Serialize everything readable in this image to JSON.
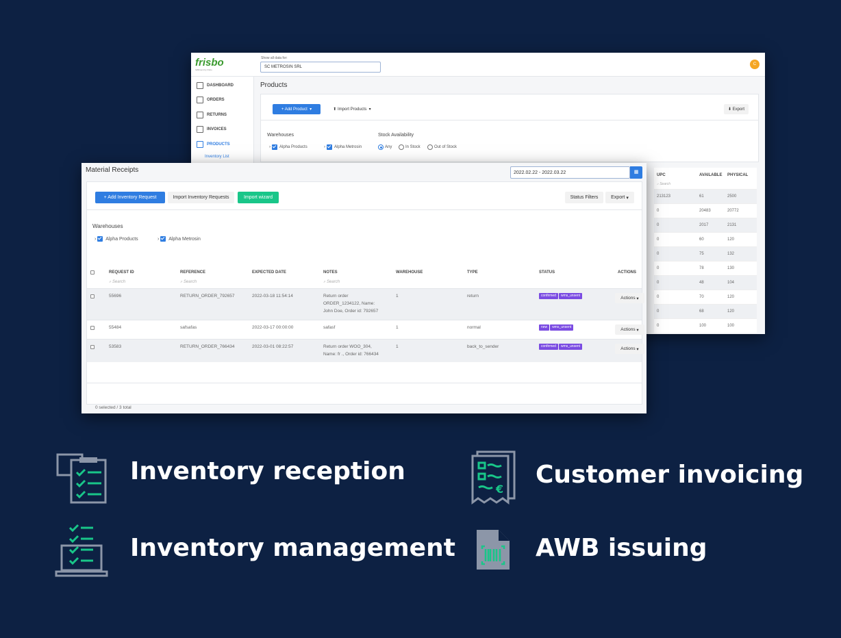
{
  "bg": {
    "logo": "frisbo",
    "logo_sub": "fulfillment by frisbo",
    "show_label": "Show all data for:",
    "company": "SC METROSIN SRL",
    "avatar": "C",
    "nav": [
      {
        "label": "DASHBOARD",
        "icon": "bar-chart-icon"
      },
      {
        "label": "ORDERS",
        "icon": "cart-icon"
      },
      {
        "label": "RETURNS",
        "icon": "return-box-icon"
      },
      {
        "label": "INVOICES",
        "icon": "invoice-icon"
      },
      {
        "label": "PRODUCTS",
        "icon": "list-icon"
      }
    ],
    "subnav": "Inventory List",
    "page_title": "Products",
    "add_product": "+ Add Product",
    "import_products": "Import Products",
    "export": "Export",
    "warehouses_label": "Warehouses",
    "wh1": "Alpha Products",
    "wh2": "Alpha Metrosin",
    "stock_label": "Stock Availability",
    "stock_options": [
      "Any",
      "In Stock",
      "Out of Stock"
    ],
    "stock_selected": "Any",
    "table": {
      "headers": [
        "UPC",
        "AVAILABLE",
        "PHYSICAL"
      ],
      "search": "Search",
      "rows": [
        [
          "213123",
          "61",
          "2500"
        ],
        [
          "0",
          "20483",
          "20772"
        ],
        [
          "0",
          "2017",
          "2131"
        ],
        [
          "0",
          "60",
          "120"
        ],
        [
          "0",
          "75",
          "132"
        ],
        [
          "0",
          "78",
          "130"
        ],
        [
          "0",
          "48",
          "104"
        ],
        [
          "0",
          "70",
          "120"
        ],
        [
          "0",
          "68",
          "120"
        ],
        [
          "0",
          "100",
          "100"
        ]
      ]
    }
  },
  "fg": {
    "title": "Material Receipts",
    "date_range": "2022.02.22 - 2022.03.22",
    "add_request": "+ Add Inventory Request",
    "import_requests": "Import Inventory Requests",
    "import_wizard": "Import wizard",
    "status_filters": "Status Filters",
    "export": "Export",
    "warehouses_label": "Warehouses",
    "wh1": "Alpha Products",
    "wh2": "Alpha Metrosin",
    "headers": [
      "REQUEST ID",
      "REFERENCE",
      "EXPECTED DATE",
      "NOTES",
      "WAREHOUSE",
      "TYPE",
      "STATUS",
      "ACTIONS"
    ],
    "search": "Search",
    "rows": [
      {
        "id": "55696",
        "ref": "RETURN_ORDER_792657",
        "date": "2022-03-18 11:54:14",
        "notes": [
          "Return order",
          "ORDER_1234122, Name:",
          "John Doe, Order id: 792657"
        ],
        "wh": "1",
        "type": "return",
        "badges": [
          "confirmed",
          "wms_unsent"
        ]
      },
      {
        "id": "55484",
        "ref": "safsafas",
        "date": "2022-03-17 00:00:00",
        "notes": [
          "safasf"
        ],
        "wh": "1",
        "type": "normal",
        "badges": [
          "new",
          "wms_unsent"
        ]
      },
      {
        "id": "53583",
        "ref": "RETURN_ORDER_766434",
        "date": "2022-03-01 08:22:57",
        "notes": [
          "Return order WOO_304,",
          "Name: fr ., Order id: 766434"
        ],
        "wh": "1",
        "type": "back_to_sender",
        "badges": [
          "confirmed",
          "wms_unsent"
        ]
      }
    ],
    "actions": "Actions",
    "footer": "0 selected / 3 total"
  },
  "features": [
    {
      "label": "Inventory reception",
      "icon": "clipboard-checklist-icon"
    },
    {
      "label": "Customer invoicing",
      "icon": "receipt-euro-icon"
    },
    {
      "label": "Inventory management",
      "icon": "laptop-checklist-icon"
    },
    {
      "label": "AWB issuing",
      "icon": "barcode-document-icon"
    }
  ],
  "colors": {
    "background": "#0d2143",
    "accent_green": "#19c689",
    "icon_grey": "#8c96a8"
  }
}
